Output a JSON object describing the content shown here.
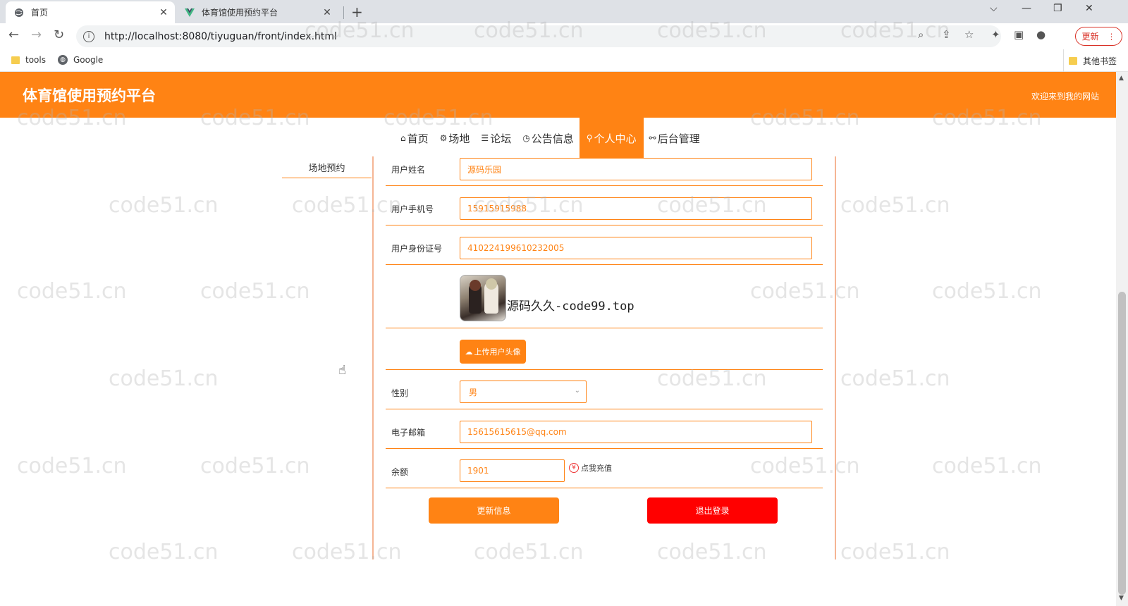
{
  "browser": {
    "tabs": [
      {
        "title": "首页",
        "active": true
      },
      {
        "title": "体育馆使用预约平台",
        "active": false
      }
    ],
    "new_tab_symbol": "+",
    "url": "http://localhost:8080/tiyuguan/front/index.html",
    "update_label": "更新",
    "bookmarks": [
      {
        "label": "tools",
        "icon": "folder-icon"
      },
      {
        "label": "Google",
        "icon": "globe-icon"
      }
    ],
    "other_bookmarks": "其他书签"
  },
  "header": {
    "site_title": "体育馆使用预约平台",
    "welcome": "欢迎来到我的网站",
    "color": "#ff8314"
  },
  "nav": {
    "items": [
      {
        "icon": "⌂",
        "label": "首页"
      },
      {
        "icon": "⚙",
        "label": "场地"
      },
      {
        "icon": "☰",
        "label": "论坛"
      },
      {
        "icon": "◷",
        "label": "公告信息"
      },
      {
        "icon": "⚲",
        "label": "个人中心",
        "active": true
      },
      {
        "icon": "⚯",
        "label": "后台管理"
      }
    ]
  },
  "sidebar": {
    "items": [
      {
        "label": "场地预约"
      }
    ]
  },
  "form": {
    "name_label": "用户姓名",
    "name_value": "源码乐园",
    "phone_label": "用户手机号",
    "phone_value": "15915915988",
    "idcard_label": "用户身份证号",
    "idcard_value": "410224199610232005",
    "avatar_caption": "源码久久-code99.top",
    "upload_label": "上传用户头像",
    "gender_label": "性别",
    "gender_value": "男",
    "email_label": "电子邮箱",
    "email_value": "15615615615@qq.com",
    "balance_label": "余额",
    "balance_value": "1901",
    "recharge_label": "点我充值",
    "recharge_icon": "¥",
    "update_button": "更新信息",
    "logout_button": "退出登录"
  },
  "watermark": "code51.cn",
  "colors": {
    "accent": "#ff8314",
    "danger": "#ff0000"
  }
}
